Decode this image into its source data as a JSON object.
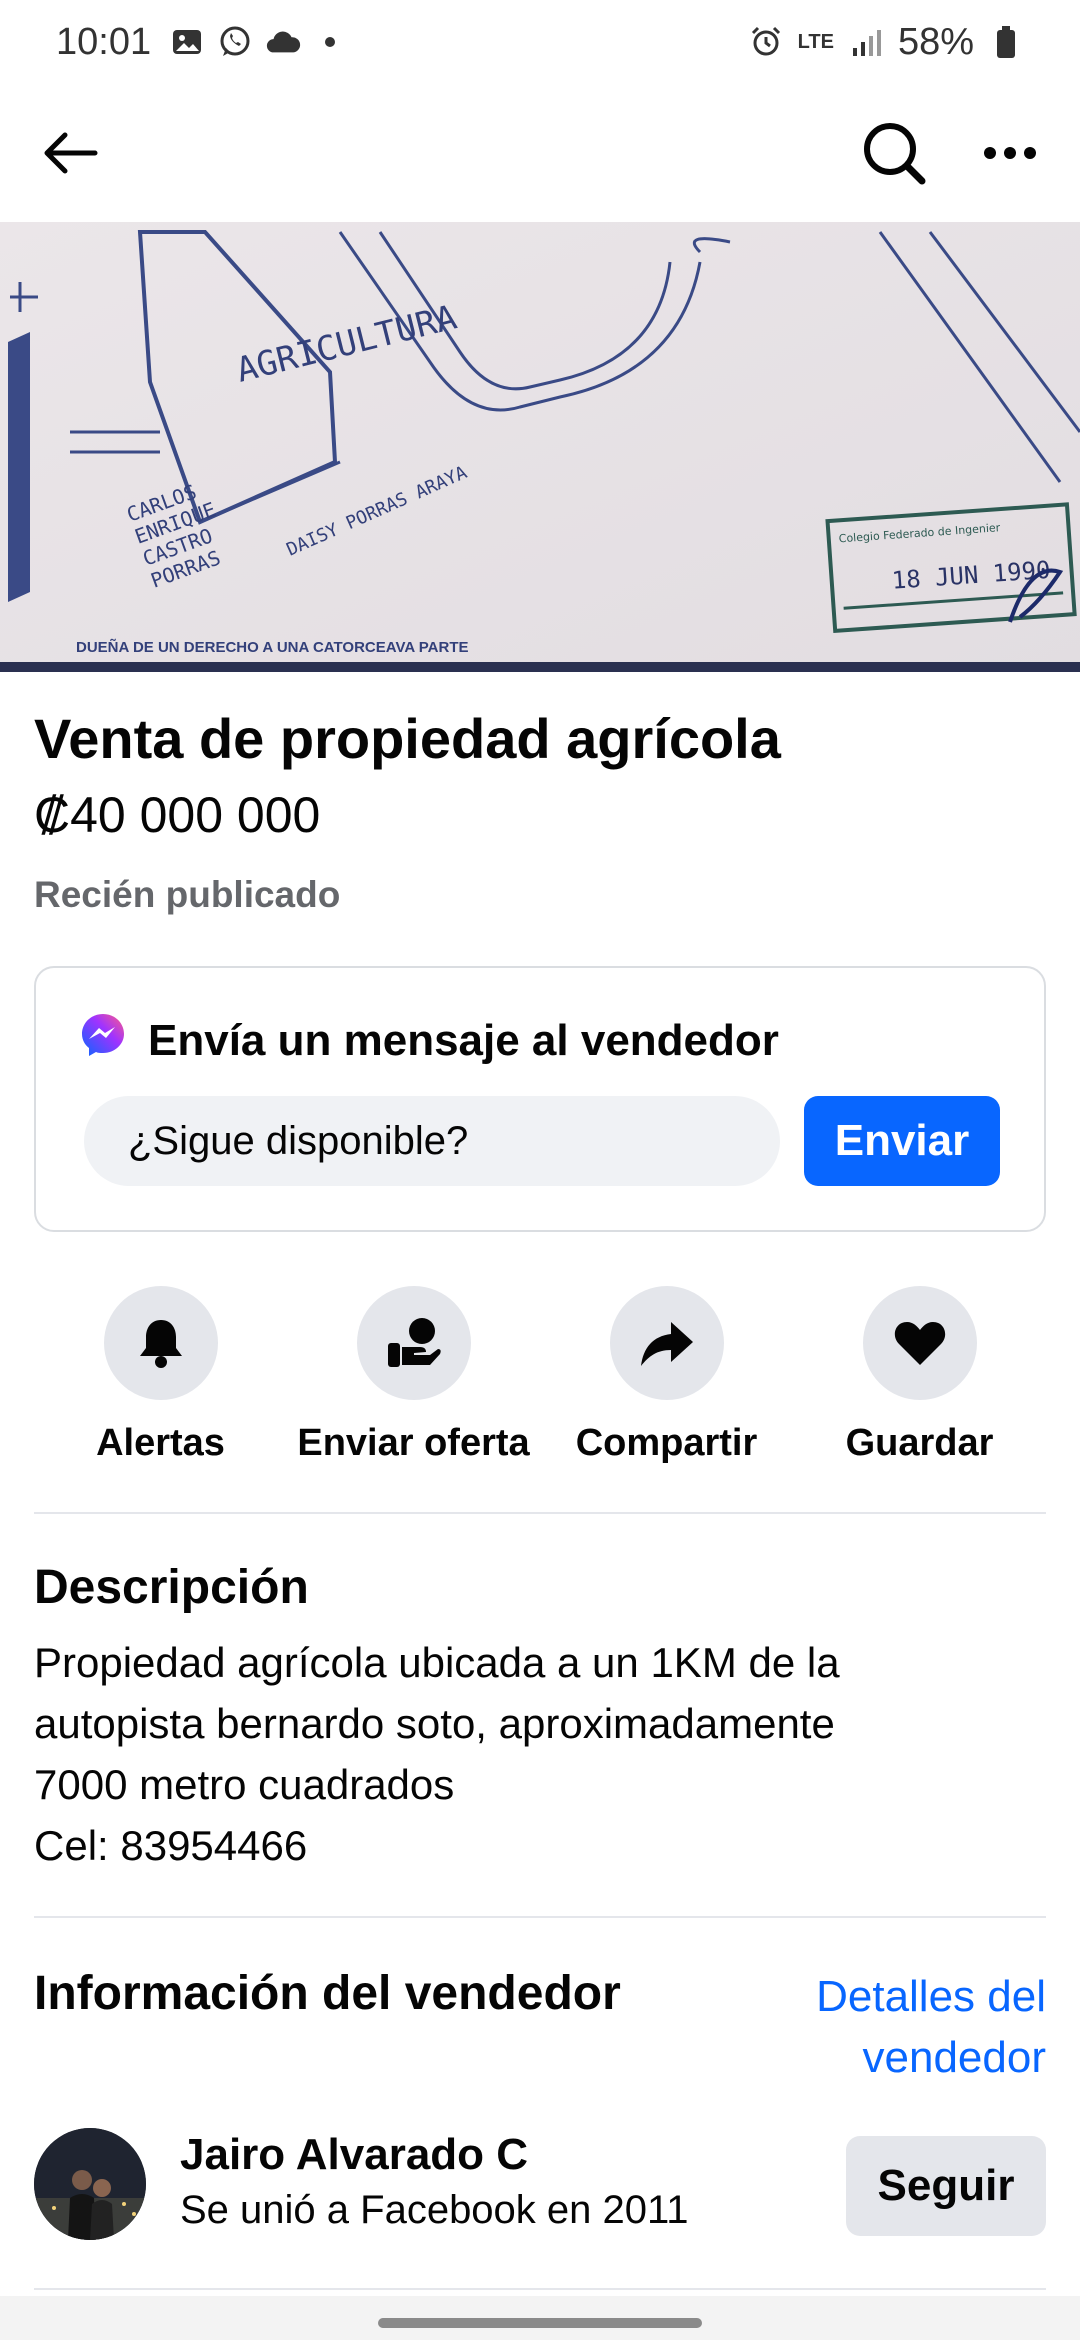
{
  "status_bar": {
    "time": "10:01",
    "network": "LTE",
    "battery": "58%"
  },
  "header": {
    "back_icon": "arrow-left-icon",
    "search_icon": "search-icon",
    "more_icon": "more-horizontal-icon"
  },
  "hero": {
    "annotations": {
      "agricultura": "AGRICULTURA",
      "carlos": "CARLOS",
      "enrique": "ENRIQUE",
      "castro": "CASTRO",
      "porras": "PORRAS",
      "daisy": "DAISY PORRAS ARAYA",
      "stamp_title": "Colegio Federado de Ingenier",
      "stamp_date": "18 JUN 1990",
      "bottom": "DUEÑA DE UN DERECHO A UNA CATORCEAVA PARTE"
    }
  },
  "listing": {
    "title": "Venta de propiedad agrícola",
    "price": "₡40 000 000",
    "posted": "Recién publicado"
  },
  "message": {
    "heading": "Envía un mensaje al vendedor",
    "input_value": "¿Sigue disponible?",
    "send_label": "Enviar",
    "brand_color": "#0866ff"
  },
  "actions": [
    {
      "label": "Alertas",
      "icon": "bell-icon"
    },
    {
      "label": "Enviar oferta",
      "icon": "offer-hand-icon"
    },
    {
      "label": "Compartir",
      "icon": "share-arrow-icon"
    },
    {
      "label": "Guardar",
      "icon": "heart-icon"
    }
  ],
  "description": {
    "heading": "Descripción",
    "line1": "Propiedad agrícola ubicada a un 1KM de la",
    "line2": "autopista bernardo soto, aproximadamente",
    "line3": "7000 metro cuadrados",
    "line4": "Cel: 83954466"
  },
  "seller": {
    "heading": "Información del vendedor",
    "details_link_line1": "Detalles del",
    "details_link_line2": "vendedor",
    "name": "Jairo Alvarado C",
    "joined": "Se unió a Facebook en 2011",
    "follow_label": "Seguir"
  }
}
